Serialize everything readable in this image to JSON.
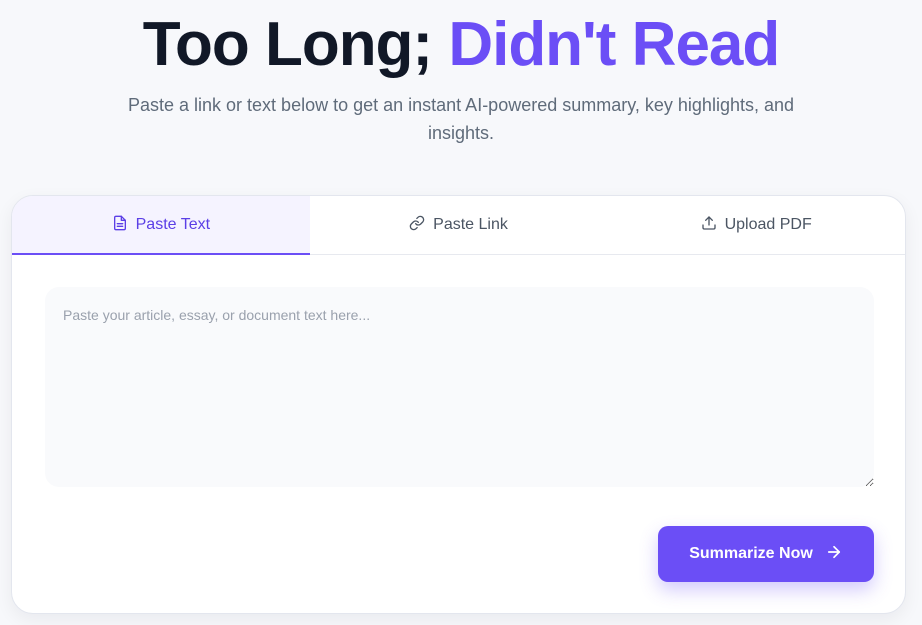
{
  "hero": {
    "title_main": "Too Long;",
    "title_accent": "Didn't Read",
    "subtitle": "Paste a link or text below to get an instant AI-powered summary, key highlights, and insights."
  },
  "tabs": [
    {
      "label": "Paste Text",
      "icon": "document-icon",
      "active": true
    },
    {
      "label": "Paste Link",
      "icon": "link-icon",
      "active": false
    },
    {
      "label": "Upload PDF",
      "icon": "upload-icon",
      "active": false
    }
  ],
  "input": {
    "value": "",
    "placeholder": "Paste your article, essay, or document text here..."
  },
  "actions": {
    "summarize_label": "Summarize Now",
    "summarize_icon": "arrow-right-icon"
  },
  "colors": {
    "accent": "#6b4ef6",
    "title": "#111827",
    "background": "#f7f8fb"
  }
}
